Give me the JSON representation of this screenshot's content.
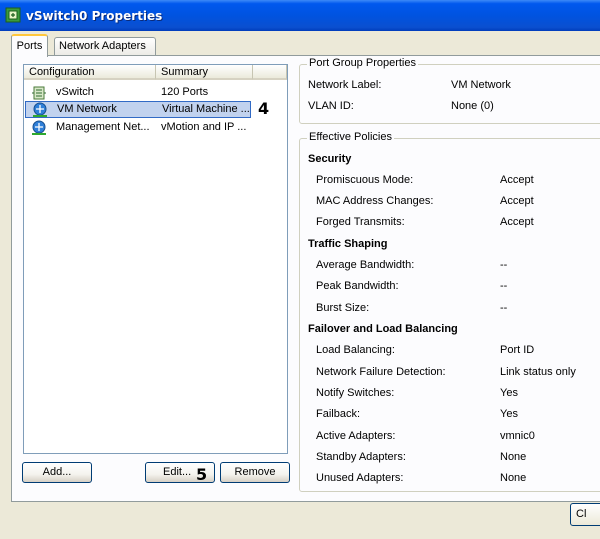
{
  "window": {
    "title": "vSwitch0 Properties",
    "icon": "vswitch-window-icon"
  },
  "tabs": [
    {
      "label": "Ports",
      "active": true
    },
    {
      "label": "Network Adapters",
      "active": false
    }
  ],
  "list": {
    "columns": [
      "Configuration",
      "Summary"
    ],
    "rows": [
      {
        "icon": "vswitch-icon",
        "configuration": "vSwitch",
        "summary": "120 Ports",
        "selected": false
      },
      {
        "icon": "port-group-icon",
        "configuration": "VM Network",
        "summary": "Virtual Machine ...",
        "selected": true
      },
      {
        "icon": "port-group-icon",
        "configuration": "Management Net...",
        "summary": "vMotion and IP ...",
        "selected": false
      }
    ]
  },
  "annotations": {
    "row_marker": "4",
    "edit_marker": "5"
  },
  "buttons": {
    "add": "Add...",
    "edit": "Edit...",
    "remove": "Remove",
    "close_partial": "Cl"
  },
  "port_group": {
    "legend": "Port Group Properties",
    "network_label_key": "Network Label:",
    "network_label_value": "VM Network",
    "vlan_key": "VLAN ID:",
    "vlan_value": "None (0)"
  },
  "effective_policies": {
    "legend": "Effective Policies",
    "security": {
      "heading": "Security",
      "items": [
        {
          "key": "Promiscuous Mode:",
          "value": "Accept"
        },
        {
          "key": "MAC Address Changes:",
          "value": "Accept"
        },
        {
          "key": "Forged Transmits:",
          "value": "Accept"
        }
      ]
    },
    "traffic_shaping": {
      "heading": "Traffic Shaping",
      "items": [
        {
          "key": "Average Bandwidth:",
          "value": "--"
        },
        {
          "key": "Peak Bandwidth:",
          "value": "--"
        },
        {
          "key": "Burst Size:",
          "value": "--"
        }
      ]
    },
    "failover": {
      "heading": "Failover and Load Balancing",
      "items": [
        {
          "key": "Load Balancing:",
          "value": "Port ID"
        },
        {
          "key": "Network Failure Detection:",
          "value": "Link status only"
        },
        {
          "key": "Notify Switches:",
          "value": "Yes"
        },
        {
          "key": "Failback:",
          "value": "Yes"
        },
        {
          "key": "Active Adapters:",
          "value": "vmnic0"
        },
        {
          "key": "Standby Adapters:",
          "value": "None"
        },
        {
          "key": "Unused Adapters:",
          "value": "None"
        }
      ]
    }
  },
  "colors": {
    "title_bar": "#0058ee",
    "selection": "#c1d2ee",
    "dialog_bg": "#ece9d8"
  }
}
